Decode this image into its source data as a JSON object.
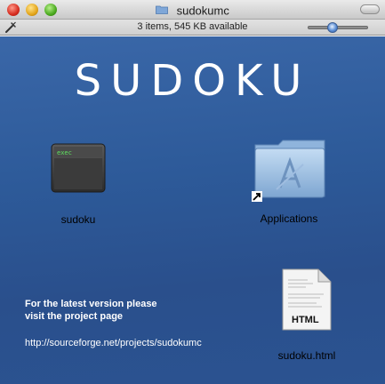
{
  "window": {
    "title": "sudokumc",
    "status": "3 items, 545 KB available"
  },
  "view": {
    "icon_size_slider": 0.4
  },
  "content": {
    "banner": "SUDOKU",
    "info_line1": "For the latest version please",
    "info_line2": "visit the project page",
    "url": "http://sourceforge.net/projects/sudokumc"
  },
  "items": {
    "executable": {
      "label": "sudoku",
      "icon_text": "exec",
      "icon": "terminal-exec-icon"
    },
    "applications": {
      "label": "Applications",
      "icon": "applications-folder-icon"
    },
    "html_file": {
      "label": "sudoku.html",
      "icon_text": "HTML",
      "icon": "html-document-icon"
    }
  },
  "colors": {
    "background_top": "#3a67a8",
    "background_bottom": "#2a4f8c",
    "banner": "#ffffff"
  }
}
